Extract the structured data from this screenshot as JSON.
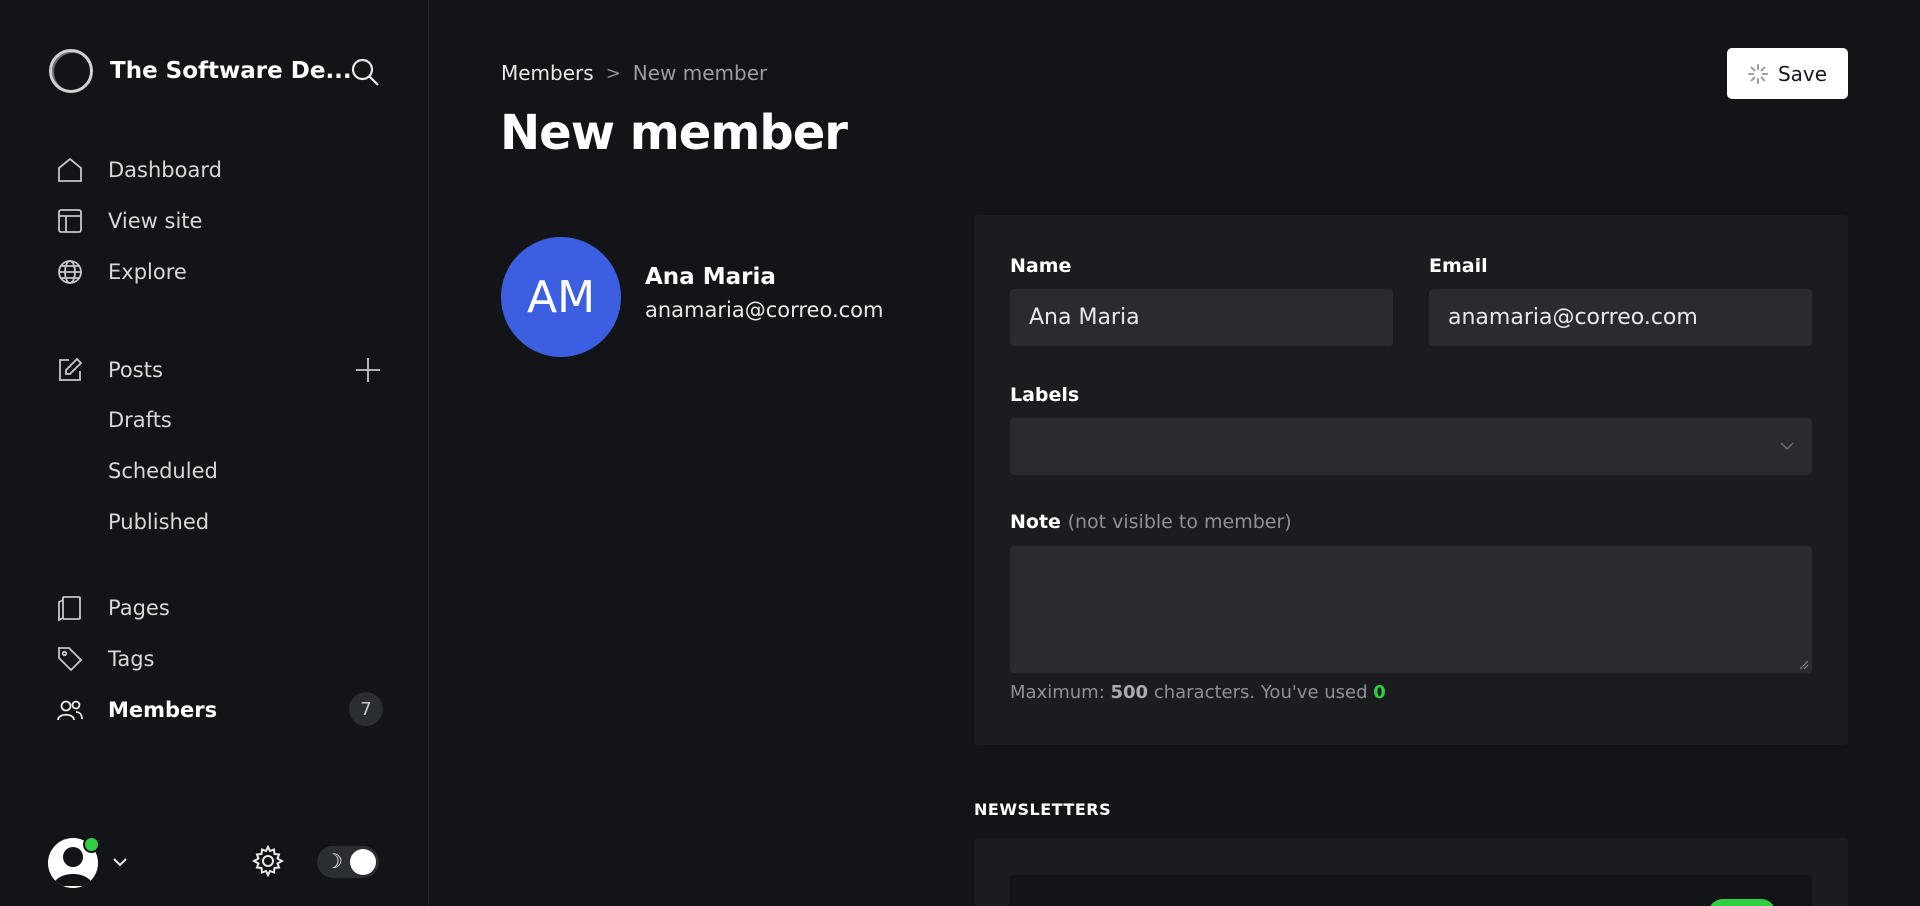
{
  "sidebar": {
    "site_title": "The Software De...",
    "nav": {
      "dashboard": "Dashboard",
      "view_site": "View site",
      "explore": "Explore",
      "posts": "Posts",
      "drafts": "Drafts",
      "scheduled": "Scheduled",
      "published": "Published",
      "pages": "Pages",
      "tags": "Tags",
      "members": "Members",
      "members_count": "7"
    },
    "theme_toggle_symbol": "☽"
  },
  "header": {
    "breadcrumb_parent": "Members",
    "breadcrumb_separator": ">",
    "breadcrumb_current": "New member",
    "title": "New member",
    "save_label": "Save"
  },
  "member": {
    "initials": "AM",
    "name": "Ana Maria",
    "email": "anamaria@correo.com"
  },
  "form": {
    "name_label": "Name",
    "name_value": "Ana Maria",
    "email_label": "Email",
    "email_value": "anamaria@correo.com",
    "labels_label": "Labels",
    "labels_value": "",
    "note_label": "Note",
    "note_hint": "(not visible to member)",
    "note_value": "",
    "char_prefix": "Maximum:",
    "char_max": "500",
    "char_middle": "characters. You've used",
    "char_used": "0"
  },
  "newsletters": {
    "heading": "NEWSLETTERS"
  },
  "colors": {
    "accent_green": "#30cf43",
    "avatar_blue": "#3b5fe0",
    "background": "#131417",
    "card": "#1b1c20"
  },
  "icons": [
    "search-icon",
    "home-icon",
    "view-site-icon",
    "globe-icon",
    "edit-icon",
    "plus-icon",
    "pages-icon",
    "tag-icon",
    "members-icon",
    "gear-icon",
    "chevron-down-icon",
    "spinner-icon"
  ]
}
